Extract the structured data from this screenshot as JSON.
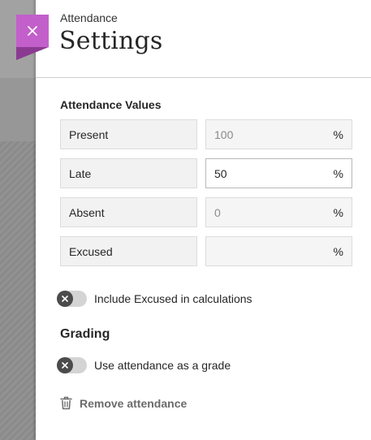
{
  "header": {
    "subtitle": "Attendance",
    "title": "Settings",
    "close_icon": "close-icon",
    "accent_color": "#c35fcb"
  },
  "attendance_values": {
    "title": "Attendance Values",
    "rows": [
      {
        "label": "Present",
        "value": "100",
        "unit": "%",
        "editable": false
      },
      {
        "label": "Late",
        "value": "50",
        "unit": "%",
        "editable": true
      },
      {
        "label": "Absent",
        "value": "0",
        "unit": "%",
        "editable": false
      },
      {
        "label": "Excused",
        "value": "",
        "unit": "%",
        "editable": false
      }
    ]
  },
  "include_excused": {
    "label": "Include Excused in calculations",
    "enabled": false
  },
  "grading": {
    "title": "Grading",
    "toggle_label": "Use attendance as a grade",
    "enabled": false
  },
  "remove": {
    "label": "Remove attendance",
    "icon": "trash-icon"
  }
}
